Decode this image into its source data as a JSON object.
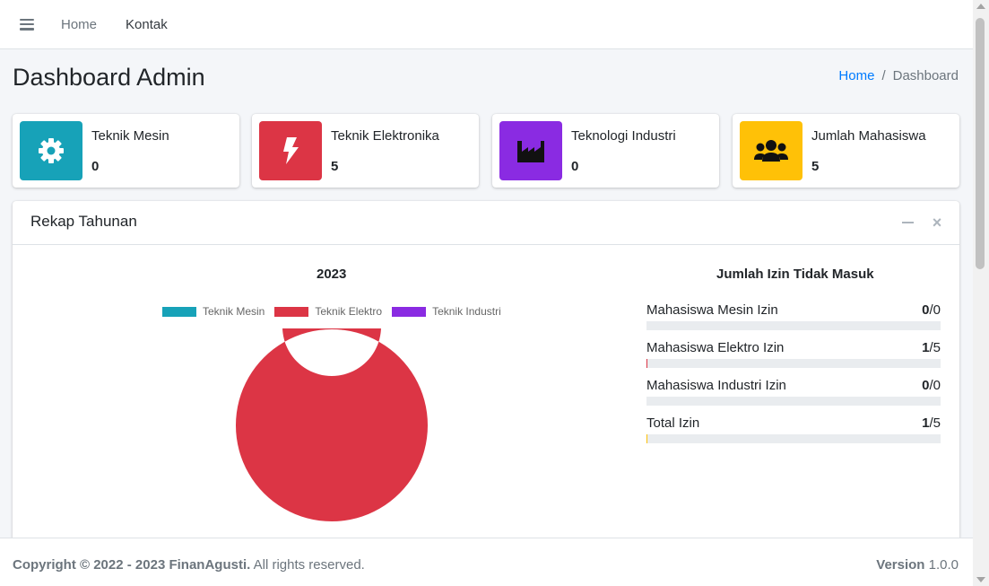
{
  "navbar": {
    "links": [
      "Home",
      "Kontak"
    ]
  },
  "header": {
    "title": "Dashboard Admin",
    "breadcrumb": {
      "home": "Home",
      "separator": "/",
      "active": "Dashboard"
    }
  },
  "info_boxes": [
    {
      "label": "Teknik Mesin",
      "value": "0",
      "icon": "gear-icon",
      "color": "#17a2b8"
    },
    {
      "label": "Teknik Elektronika",
      "value": "5",
      "icon": "bolt-icon",
      "color": "#dc3545"
    },
    {
      "label": "Teknologi Industri",
      "value": "0",
      "icon": "industry-icon",
      "color": "#8a2be2"
    },
    {
      "label": "Jumlah Mahasiswa",
      "value": "5",
      "icon": "users-icon",
      "color": "#ffc107"
    }
  ],
  "card": {
    "title": "Rekap Tahunan",
    "progress_title": "Jumlah Izin Tidak Masuk",
    "progress": [
      {
        "label": "Mahasiswa Mesin Izin",
        "value": "0",
        "total": "/0",
        "fraction": 0,
        "color": "#17a2b8"
      },
      {
        "label": "Mahasiswa Elektro Izin",
        "value": "1",
        "total": "/5",
        "fraction": 0.004,
        "color": "#dc3545"
      },
      {
        "label": "Mahasiswa Industri Izin",
        "value": "0",
        "total": "/0",
        "fraction": 0,
        "color": "#8a2be2"
      },
      {
        "label": "Total Izin",
        "value": "1",
        "total": "/5",
        "fraction": 0.004,
        "color": "#ffc107"
      }
    ]
  },
  "chart_data": {
    "type": "pie",
    "title": "2023",
    "donut": true,
    "legend_position": "top",
    "categories": [
      "Teknik Mesin",
      "Teknik Elektro",
      "Teknik Industri"
    ],
    "values": [
      0,
      5,
      0
    ],
    "colors": [
      "#17a2b8",
      "#dc3545",
      "#8a2be2"
    ]
  },
  "footer": {
    "copyright": "Copyright © 2022 - 2023 FinanAgusti.",
    "rights": " All rights reserved.",
    "version_label": "Version",
    "version_value": " 1.0.0"
  }
}
